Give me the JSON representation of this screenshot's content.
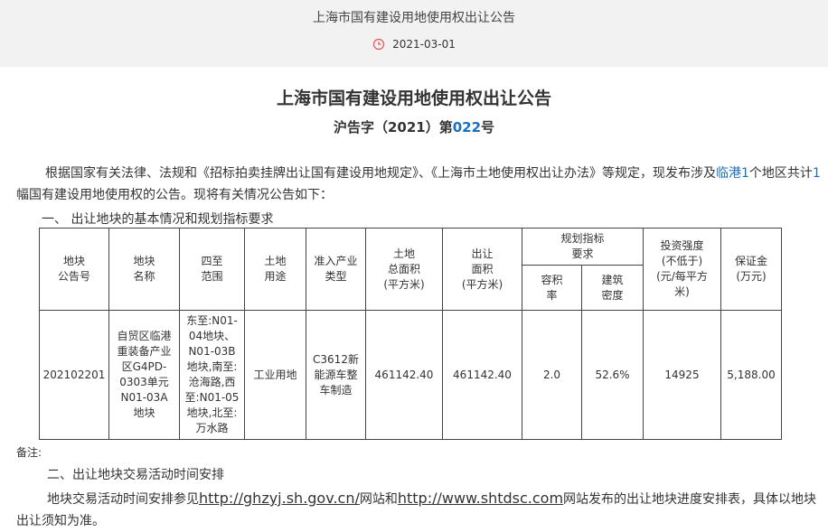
{
  "header": {
    "title": "上海市国有建设用地使用权出让公告",
    "date": "2021-03-01",
    "date_icon": "clock-icon",
    "accent_color": "#e8545a"
  },
  "document": {
    "title": "上海市国有建设用地使用权出让公告",
    "number_prefix": "沪告字（2021）第",
    "number": "022",
    "number_suffix": "号",
    "intro": {
      "part1": "根据国家有关法律、法规和《招标拍卖挂牌出让国有建设用地规定》、《上海市土地使用权出让办法》等规定，现发布涉及",
      "link1": "临港1",
      "part2": "个地区共计",
      "link2": "1",
      "part3": "幅国有建设用地使用权的公告。现将有关情况公告如下："
    },
    "section1_title": "一、 出让地块的基本情况和规划指标要求",
    "table": {
      "headers": {
        "plot_no": "地块\n公告号",
        "plot_name": "地块\n名称",
        "boundaries": "四至\n范围",
        "land_use": "土地\n用途",
        "industry": "准入产业\n类型",
        "total_area": "土地\n总面积\n(平方米)",
        "transfer_area": "出让\n面积\n(平方米)",
        "planning": "规划指标\n要求",
        "far": "容积\n率",
        "density": "建筑\n密度",
        "investment": "投资强度\n(不低于)\n(元/每平方\n米)",
        "deposit": "保证金\n(万元)"
      },
      "rows": [
        {
          "plot_no": "202102201",
          "plot_name": "自贸区临港\n重装备产业\n区G4PD-\n0303单元\nN01-03A\n地块",
          "boundaries": "东至:N01-\n04地块、\nN01-03B\n地块,南至:\n沧海路,西\n至:N01-05\n地块,北至:\n万水路",
          "land_use": "工业用地",
          "industry": "C3612新\n能源车整\n车制造",
          "total_area": "461142.40",
          "transfer_area": "461142.40",
          "far": "2.0",
          "density": "52.6%",
          "investment": "14925",
          "deposit": "5,188.00"
        }
      ]
    },
    "remark": "备注:",
    "section2_title": "二、出让地块交易活动时间安排",
    "schedule": {
      "part1": "地块交易活动时间安排参见",
      "url1": "http://ghzyj.sh.gov.cn/",
      "part2": "网站和",
      "url2": "http://www.shtdsc.com",
      "part3": "网站发布的出让地块进度安排表，具体以地块出让须知为准。"
    }
  }
}
